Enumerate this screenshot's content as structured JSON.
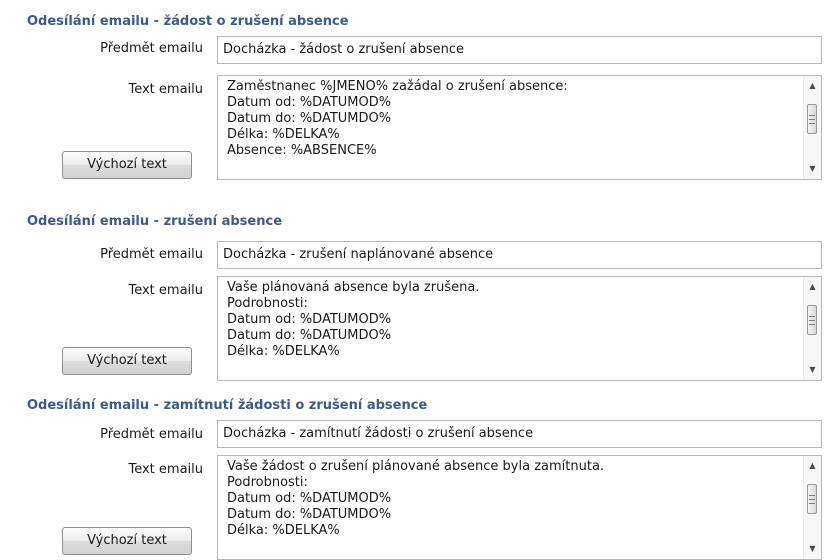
{
  "sections": [
    {
      "title": "Odesílání emailu - žádost o zrušení absence",
      "subject_label": "Předmět emailu",
      "subject_value": "Docházka - žádost o zrušení absence",
      "text_label": "Text emailu",
      "text_lines": [
        "Zaměstnanec %JMENO% zažádal o zrušení absence:",
        "Datum od: %DATUMOD%",
        "Datum do: %DATUMDO%",
        "Délka: %DELKA%",
        "Absence: %ABSENCE%"
      ],
      "default_button": "Výchozí text"
    },
    {
      "title": "Odesílání emailu - zrušení absence",
      "subject_label": "Předmět emailu",
      "subject_value": "Docházka - zrušení naplánované absence",
      "text_label": "Text emailu",
      "text_lines": [
        "Vaše plánovaná absence byla zrušena.",
        "Podrobnosti:",
        "Datum od: %DATUMOD%",
        "Datum do: %DATUMDO%",
        "Délka: %DELKA%"
      ],
      "default_button": "Výchozí text"
    },
    {
      "title": "Odesílání emailu - zamítnutí žádosti o zrušení absence",
      "subject_label": "Předmět emailu",
      "subject_value": "Docházka - zamítnutí žádosti o zrušení absence",
      "text_label": "Text emailu",
      "text_lines": [
        "Vaše žádost o zrušení plánované absence byla zamítnuta.",
        "Podrobnosti:",
        "Datum od: %DATUMOD%",
        "Datum do: %DATUMDO%",
        "Délka: %DELKA%"
      ],
      "default_button": "Výchozí text"
    }
  ]
}
